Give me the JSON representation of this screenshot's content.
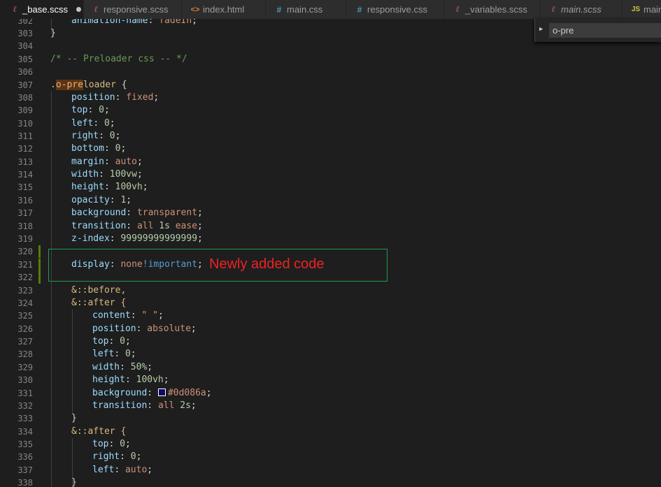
{
  "tabs": [
    {
      "label": "_base.scss",
      "icon": "sass-icon",
      "active": true,
      "dirty": true
    },
    {
      "label": "responsive.scss",
      "icon": "sass-icon"
    },
    {
      "label": "index.html",
      "icon": "html-icon"
    },
    {
      "label": "main.css",
      "icon": "css-icon"
    },
    {
      "label": "responsive.css",
      "icon": "css-icon"
    },
    {
      "label": "_variables.scss",
      "icon": "sass-icon"
    },
    {
      "label": "main.scss",
      "icon": "sass-icon",
      "italic": true
    },
    {
      "label": "main",
      "icon": "js-icon"
    }
  ],
  "icon_glyphs": {
    "sass": "ℓ",
    "html": "<>",
    "css": "#",
    "js": "JS"
  },
  "find": {
    "value": "o-pre",
    "trailing": "/"
  },
  "colors": {
    "background": "#1e1e1e",
    "comment": "#6a9955",
    "selector": "#d7ba7d",
    "property": "#9cdcfe",
    "value": "#ce9178",
    "number": "#b5cea8",
    "keyword": "#569cd6",
    "annotation_border": "#1e9a57",
    "annotation_text": "#ee2222",
    "modified_marker": "#587c0c"
  },
  "line_numbers": [
    "302",
    "303",
    "304",
    "305",
    "306",
    "307",
    "308",
    "309",
    "310",
    "311",
    "312",
    "313",
    "314",
    "315",
    "316",
    "317",
    "318",
    "319",
    "320",
    "321",
    "322",
    "323",
    "324",
    "325",
    "326",
    "327",
    "328",
    "329",
    "330",
    "331",
    "332",
    "333",
    "334",
    "335",
    "336",
    "337",
    "338"
  ],
  "code": {
    "l302_prop": "animation-name",
    "l302_colon": ": ",
    "l302_val": "fadeIn",
    "l302_semi": ";",
    "l303": "}",
    "l305": "/* -- Preloader css -- */",
    "l307_dot": ".",
    "l307_match": "o-pre",
    "l307_rest": "loader",
    "l307_brace": " {",
    "l308_prop": "position",
    "l308_val": "fixed",
    "l309_prop": "top",
    "l309_val": "0",
    "l310_prop": "left",
    "l310_val": "0",
    "l311_prop": "right",
    "l311_val": "0",
    "l312_prop": "bottom",
    "l312_val": "0",
    "l313_prop": "margin",
    "l313_val": "auto",
    "l314_prop": "width",
    "l314_val": "100vw",
    "l315_prop": "height",
    "l315_val": "100vh",
    "l316_prop": "opacity",
    "l316_val": "1",
    "l317_prop": "background",
    "l317_val": "transparent",
    "l318_prop": "transition",
    "l318_val1": "all",
    "l318_val2": "1s",
    "l318_val3": "ease",
    "l319_prop": "z-index",
    "l319_val": "99999999999999",
    "l321_prop": "display",
    "l321_val": "none",
    "l321_kw": "!important",
    "l323": "&::before,",
    "l324": "&::after {",
    "l325_prop": "content",
    "l325_val": "\" \"",
    "l326_prop": "position",
    "l326_val": "absolute",
    "l327_prop": "top",
    "l327_val": "0",
    "l328_prop": "left",
    "l328_val": "0",
    "l329_prop": "width",
    "l329_val": "50%",
    "l330_prop": "height",
    "l330_val": "100vh",
    "l331_prop": "background",
    "l331_val": "#0d086a",
    "l332_prop": "transition",
    "l332_val1": "all",
    "l332_val2": "2s",
    "l333": "}",
    "l334": "&::after {",
    "l335_prop": "top",
    "l335_val": "0",
    "l336_prop": "right",
    "l336_val": "0",
    "l337_prop": "left",
    "l337_val": "auto",
    "l338": "}",
    "colon": ": ",
    "semi": ";",
    "space": " "
  },
  "annotation": "Newly added code"
}
